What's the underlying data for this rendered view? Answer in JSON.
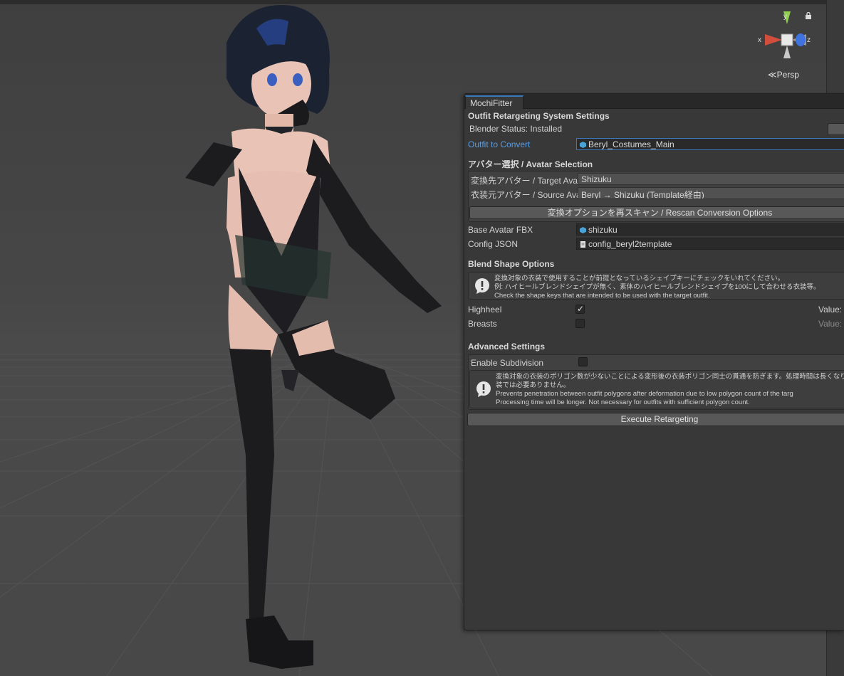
{
  "viewport": {
    "projection_label": "Persp",
    "axis_x": "x",
    "axis_y": "y",
    "axis_z": "z",
    "colors": {
      "x": "#d14e3f",
      "y": "#8fd14f",
      "z": "#3f73e0"
    }
  },
  "window": {
    "tab_label": "MochiFitter",
    "section_title": "Outfit Retargeting System Settings",
    "blender_status": "Blender Status: Installed",
    "outfit_label": "Outfit to Convert",
    "outfit_value": "Beryl_Costumes_Main"
  },
  "avatar_selection": {
    "header": "アバター選択 / Avatar Selection",
    "target_label": "変換先アバター / Target Avat",
    "target_value": "Shizuku",
    "source_label": "衣装元アバター / Source Ava",
    "source_value": "Beryl → Shizuku (Template経由)",
    "rescan_button": "変換オプションを再スキャン / Rescan Conversion Options"
  },
  "files": {
    "base_fbx_label": "Base Avatar FBX",
    "base_fbx_value": "shizuku",
    "config_label": "Config JSON",
    "config_value": "config_beryl2template"
  },
  "blend_shape": {
    "header": "Blend Shape Options",
    "help_lines": [
      "変換対象の衣装で使用することが前提となっているシェイプキーにチェックをいれてください。",
      "例: ハイヒールブレンドシェイプが無く、素体のハイヒールブレンドシェイプを100にして合わせる衣装等。",
      "Check the shape keys that are intended to be used with the target outfit."
    ],
    "items": [
      {
        "label": "Highheel",
        "checked": true,
        "value_label": "Value:"
      },
      {
        "label": "Breasts",
        "checked": false,
        "value_label": "Value:"
      }
    ]
  },
  "advanced": {
    "header": "Advanced Settings",
    "subdivision_label": "Enable Subdivision",
    "subdivision_checked": false,
    "help_lines": [
      "変換対象の衣装のポリゴン数が少ないことによる変形後の衣装ポリゴン同士の貫通を防ぎます。処理時間は長くなります。十分",
      "装では必要ありません。",
      "Prevents penetration between outfit polygons after deformation due to low polygon count of the targ",
      "Processing time will be longer. Not necessary for outfits with sufficient polygon count."
    ],
    "execute_button": "Execute Retargeting"
  }
}
